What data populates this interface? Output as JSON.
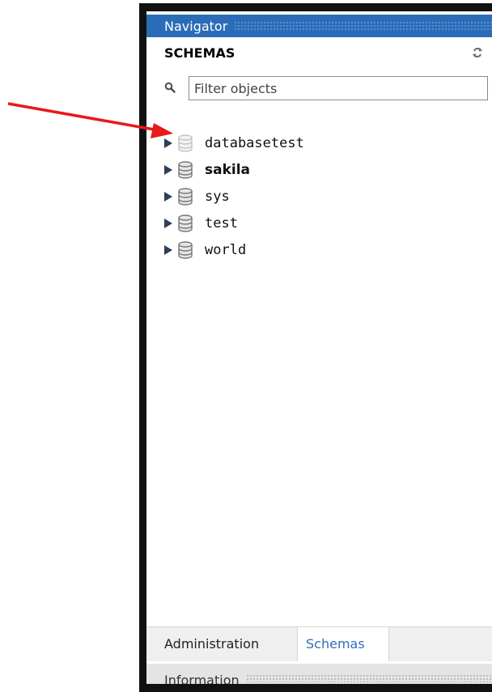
{
  "navigator": {
    "title": "Navigator",
    "header_color": "#2b6cb8"
  },
  "schemas": {
    "label": "SCHEMAS",
    "refresh_icon": "refresh-icon"
  },
  "filter": {
    "placeholder": "Filter objects",
    "value": "",
    "icon": "search-icon"
  },
  "tree": {
    "items": [
      {
        "label": "databasetest",
        "bold": false,
        "icon": "database-icon",
        "faded": true
      },
      {
        "label": "sakila",
        "bold": true,
        "icon": "database-icon",
        "faded": false
      },
      {
        "label": "sys",
        "bold": false,
        "icon": "database-icon",
        "faded": false
      },
      {
        "label": "test",
        "bold": false,
        "icon": "database-icon",
        "faded": false
      },
      {
        "label": "world",
        "bold": false,
        "icon": "database-icon",
        "faded": false
      }
    ]
  },
  "tabs": {
    "administration": "Administration",
    "schemas": "Schemas",
    "active": "Schemas",
    "active_color": "#2f6fb6"
  },
  "information": {
    "label": "Information"
  },
  "annotation": {
    "arrow_color": "#e8191b"
  }
}
